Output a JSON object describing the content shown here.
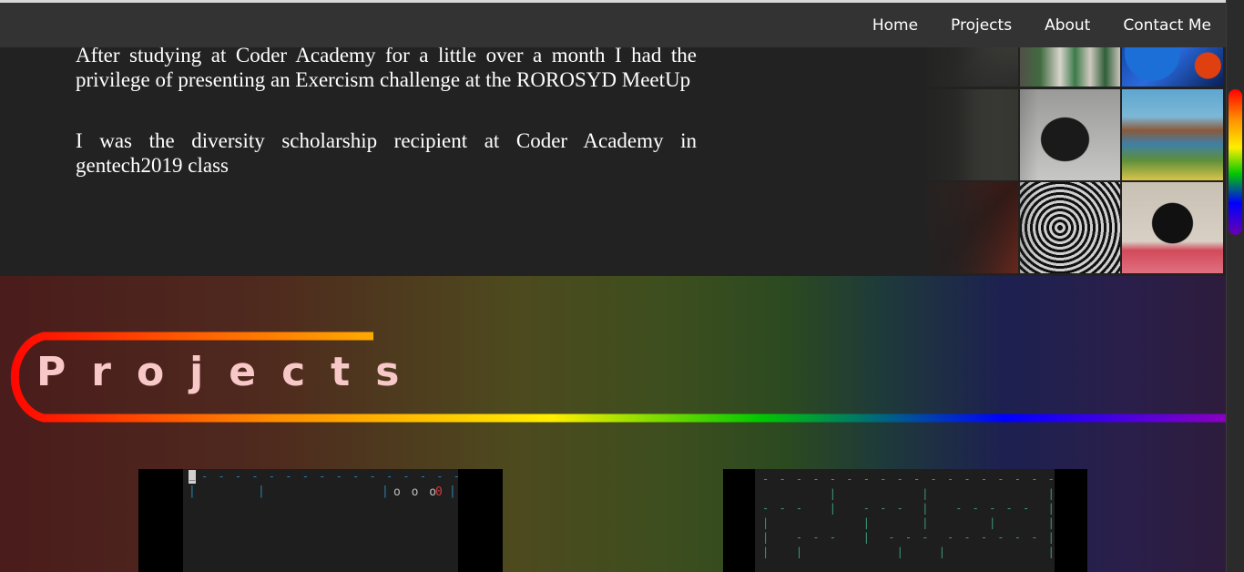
{
  "nav": {
    "links": [
      "Home",
      "Projects",
      "About",
      "Contact Me"
    ]
  },
  "about": {
    "paragraphs": [
      "After studying at Coder Academy for a little over a month I had the privilege of presenting an Exercism challenge at the ROROSYD MeetUp",
      "I was the diversity scholarship recipient at Coder Academy in gentech2019 class"
    ]
  },
  "projects": {
    "heading": "Projects"
  },
  "project_previews": {
    "game_one": {
      "top_border": "- - - - - - - - - - - - - - - - - -",
      "cursor": "_",
      "pipes": "|",
      "circles": "o o o",
      "red_zero": "0"
    },
    "game_two": {
      "maze_row_1": "- - - - - - - - - - - - - - - - - - -",
      "maze_row_2": "        |          |              |",
      "maze_row_3": "- - -   |   - - -  |   - - - - -  |",
      "maze_row_4": "|           |      |       |      |",
      "maze_row_5": "|   - - -   |  - - -  - - - - - - |",
      "maze_row_6": "|   |           |    |            |"
    }
  },
  "colors": {
    "navbar": "#333333",
    "about_bg": "#222222",
    "heading_text": "#f8c8c8",
    "rainbow": [
      "#ff0000",
      "#ff8c00",
      "#ffee00",
      "#00c800",
      "#0000ff",
      "#8a00c0"
    ]
  }
}
